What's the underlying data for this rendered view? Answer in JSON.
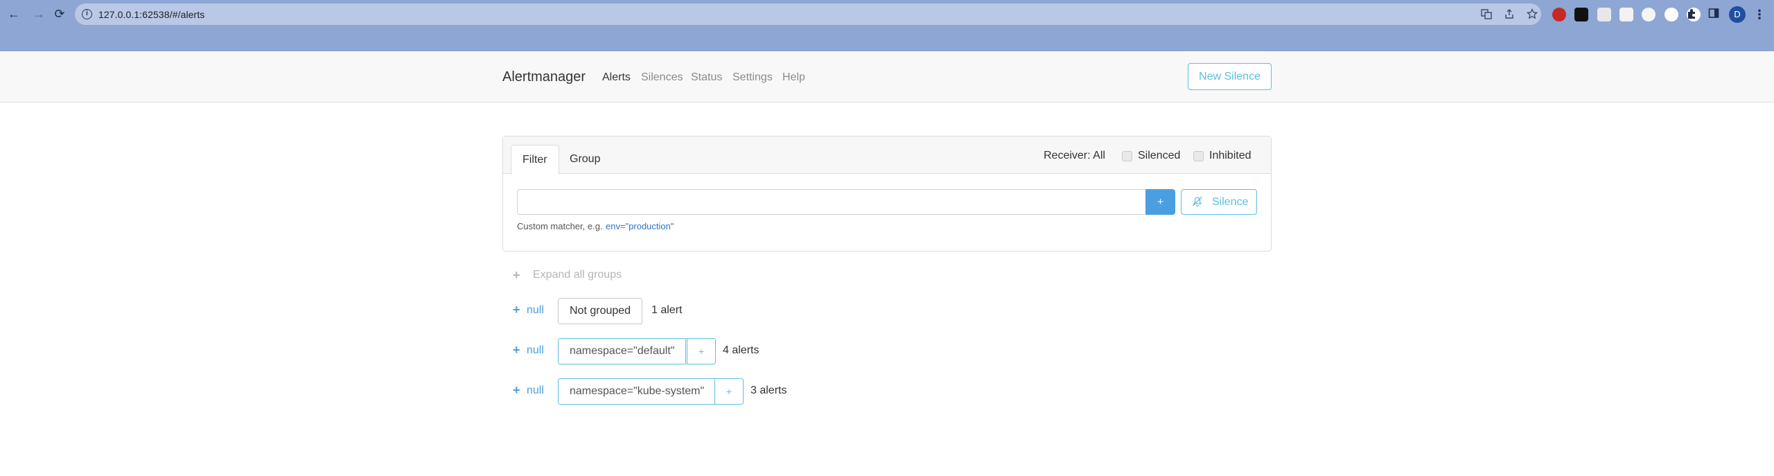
{
  "browser": {
    "url": "127.0.0.1:62538/#/alerts",
    "avatar_letter": "D",
    "back_glyph": "←",
    "forward_glyph": "→",
    "reload_glyph": "⟳",
    "info_glyph": "i",
    "menu_glyph": "⋮"
  },
  "navbar": {
    "brand": "Alertmanager",
    "links": [
      "Alerts",
      "Silences",
      "Status",
      "Settings",
      "Help"
    ],
    "active_link": "Alerts",
    "new_silence_label": "New Silence"
  },
  "filter": {
    "tabs": [
      "Filter",
      "Group"
    ],
    "active_tab": "Filter",
    "receiver_label": "Receiver: All",
    "silenced_label": "Silenced",
    "inhibited_label": "Inhibited",
    "input_value": "",
    "add_label": "+",
    "silence_label": "Silence",
    "hint_text": "Custom matcher, e.g.",
    "hint_example": "env=\"production\""
  },
  "groups": {
    "expand_all_label": "Expand all groups",
    "items": [
      {
        "toggle": "null",
        "label": "Not grouped",
        "count": "1 alert",
        "has_add": false
      },
      {
        "toggle": "null",
        "label": "namespace=\"default\"",
        "count": "4 alerts",
        "has_add": true,
        "add_label": "+"
      },
      {
        "toggle": "null",
        "label": "namespace=\"kube-system\"",
        "count": "3 alerts",
        "has_add": true,
        "add_label": "+"
      }
    ]
  },
  "colors": {
    "browser_frame": "#8ea6d3",
    "accent_blue": "#4a9fe0",
    "info_cyan": "#5bc0de"
  }
}
